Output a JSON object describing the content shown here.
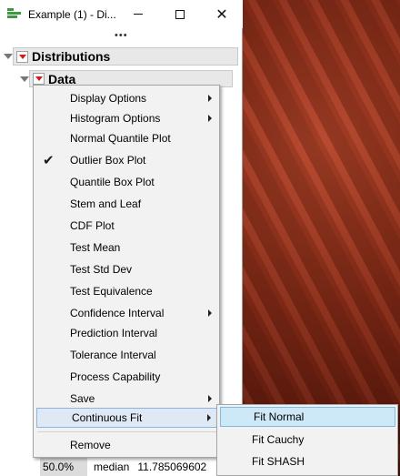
{
  "window": {
    "title": "Example (1) - Di...",
    "minimize_icon": "minimize-icon",
    "maximize_icon": "maximize-icon",
    "close_icon": "close-icon",
    "close_glyph": "✕"
  },
  "toolbar": {
    "grip": "•••"
  },
  "report": {
    "distributions_label": "Distributions",
    "data_label": "Data"
  },
  "menu": {
    "items": [
      {
        "label": "Display Options",
        "submenu": true
      },
      {
        "label": "Histogram Options",
        "submenu": true
      },
      {
        "label": "Normal Quantile Plot"
      },
      {
        "label": "Outlier Box Plot",
        "checked": true
      },
      {
        "label": "Quantile Box Plot"
      },
      {
        "label": "Stem and Leaf"
      },
      {
        "label": "CDF Plot"
      },
      {
        "label": "Test Mean"
      },
      {
        "label": "Test Std Dev"
      },
      {
        "label": "Test Equivalence"
      },
      {
        "label": "Confidence Interval",
        "submenu": true
      },
      {
        "label": "Prediction Interval"
      },
      {
        "label": "Tolerance Interval"
      },
      {
        "label": "Process Capability"
      },
      {
        "label": "Save",
        "submenu": true
      },
      {
        "label": "Continuous Fit",
        "submenu": true,
        "highlighted": true
      },
      {
        "label": "Remove"
      }
    ],
    "check_glyph": "✔"
  },
  "submenu": {
    "items": [
      {
        "label": "Fit Normal",
        "highlighted": true
      },
      {
        "label": "Fit Cauchy"
      },
      {
        "label": "Fit SHASH"
      }
    ]
  },
  "quantiles_row": {
    "percent": "50.0%",
    "label": "median",
    "value": "11.785069602"
  },
  "colors": {
    "accent_red": "#d11a1a",
    "app_icon_green": "#3f9a3f",
    "highlight_blue": "#cde8f7"
  }
}
